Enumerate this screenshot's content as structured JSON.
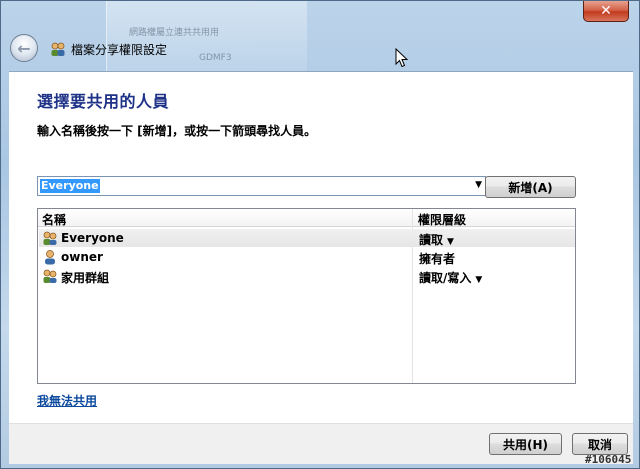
{
  "window": {
    "title": "檔案分享權限設定",
    "close_label": "✕"
  },
  "background_text": {
    "line1": "網路權屬立連共共用用",
    "line2": "GDMF3"
  },
  "main": {
    "heading": "選擇要共用的人員",
    "instruction": "輸入名稱後按一下 [新增]，或按一下箭頭尋找人員。",
    "combo_value": "Everyone",
    "add_button": "新增(A)",
    "columns": {
      "name": "名稱",
      "permission": "權限層級"
    },
    "rows": [
      {
        "name": "Everyone",
        "permission": "讀取",
        "has_dropdown": true,
        "icon": "group-icon"
      },
      {
        "name": "owner",
        "permission": "擁有者",
        "has_dropdown": false,
        "icon": "user-icon"
      },
      {
        "name": "家用群組",
        "permission": "讀取/寫入",
        "has_dropdown": true,
        "icon": "group-icon"
      }
    ],
    "help_link": "我無法共用"
  },
  "footer": {
    "share_button": "共用(H)",
    "cancel_button": "取消"
  },
  "watermark": "#106045",
  "colors": {
    "heading": "#1e3287",
    "link": "#0c4a9e",
    "selection": "#3399ff"
  }
}
